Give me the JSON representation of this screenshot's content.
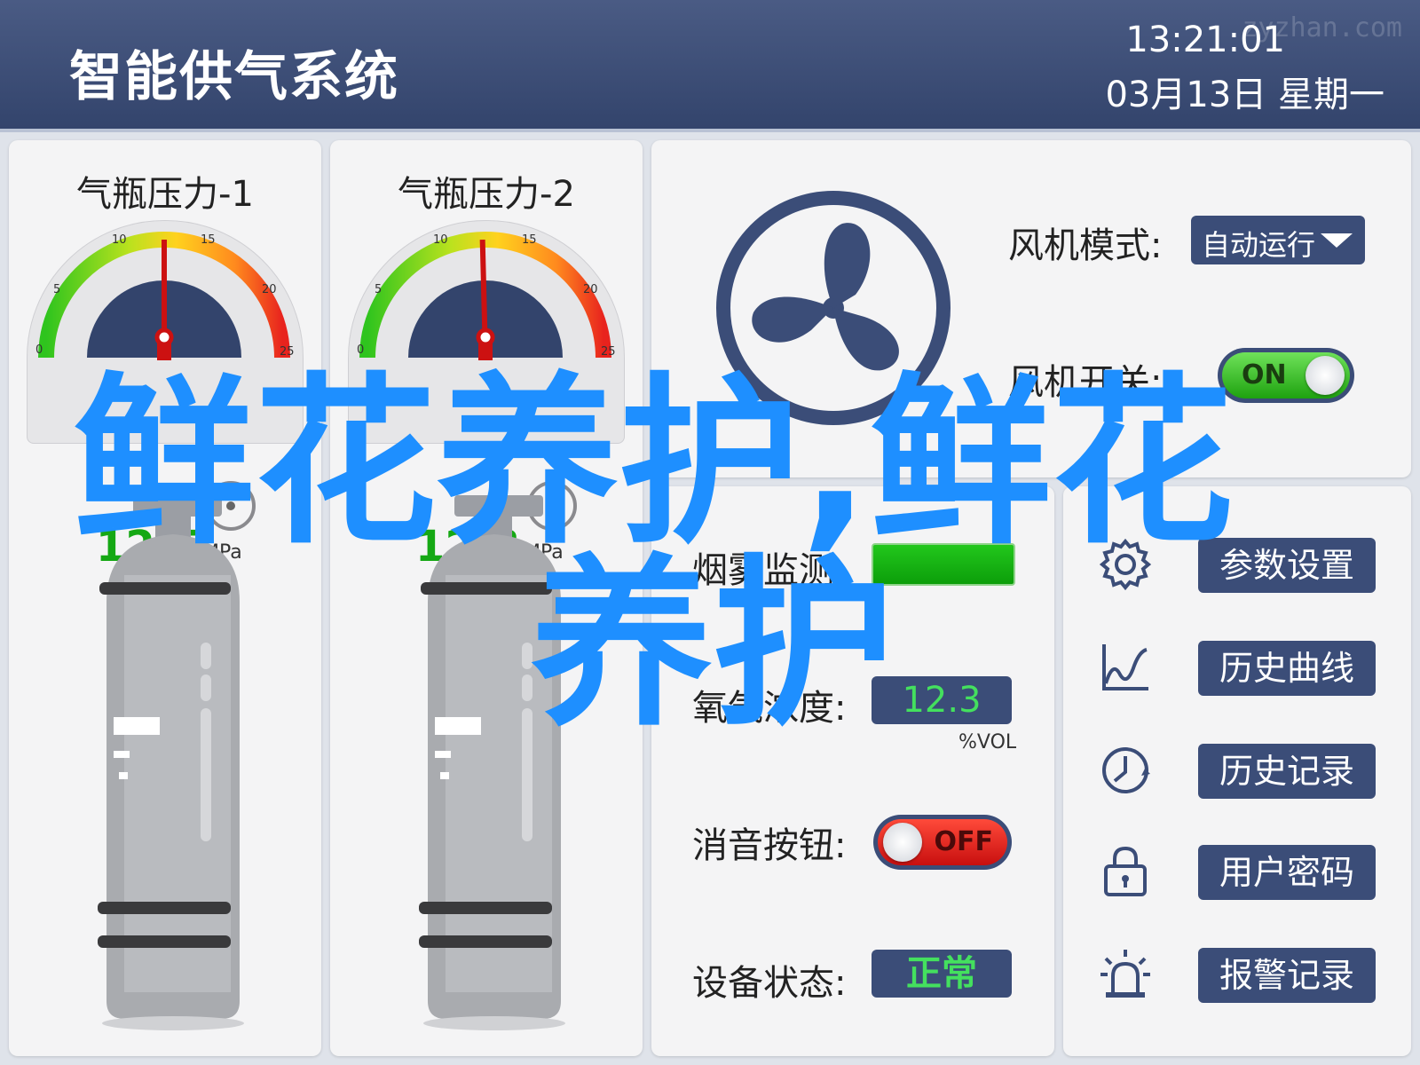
{
  "header": {
    "title": "智能供气系统",
    "time": "13:21:01",
    "date": "03月13日  星期一",
    "watermark": "zyzhan.com"
  },
  "cylinders": [
    {
      "title": "气瓶压力-1",
      "value": "12.5",
      "unit": "MPa",
      "scale_labels": [
        "0",
        "5",
        "10",
        "15",
        "20",
        "25"
      ],
      "min": 0,
      "max": 25,
      "reading": 12.5
    },
    {
      "title": "气瓶压力-2",
      "value": "12.3",
      "unit": "MPa",
      "scale_labels": [
        "0",
        "5",
        "10",
        "15",
        "20",
        "25"
      ],
      "min": 0,
      "max": 25,
      "reading": 12.3
    }
  ],
  "fan": {
    "mode_label": "风机模式:",
    "mode_value": "自动运行",
    "switch_label": "风机开关:",
    "switch_state": "ON"
  },
  "monitor": {
    "smoke_label": "烟雾监测:",
    "oxygen_label": "氧气浓度:",
    "oxygen_value": "12.3",
    "oxygen_unit": "%VOL",
    "mute_label": "消音按钮:",
    "mute_state": "OFF",
    "status_label": "设备状态:",
    "status_value": "正常"
  },
  "menu": [
    {
      "label": "参数设置",
      "icon": "gear-icon"
    },
    {
      "label": "历史曲线",
      "icon": "line-chart-icon"
    },
    {
      "label": "历史记录",
      "icon": "clock-history-icon"
    },
    {
      "label": "用户密码",
      "icon": "lock-icon"
    },
    {
      "label": "报警记录",
      "icon": "alarm-light-icon"
    }
  ],
  "overlay": {
    "line1": "鲜花养护,鲜花",
    "line2": "养护"
  },
  "colors": {
    "header": "#3b4d78",
    "button": "#3b4d78",
    "ok_green": "#15a814",
    "on_green": "#1ea20f",
    "off_red": "#c80f0f",
    "overlay_blue": "#1e8fff"
  }
}
